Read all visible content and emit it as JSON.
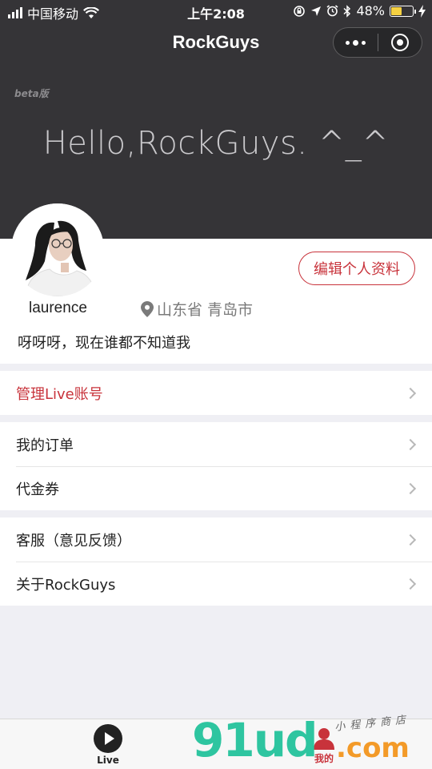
{
  "status_bar": {
    "carrier": "中国移动",
    "time": "上午2:08",
    "battery_text": "48%",
    "battery_level": 0.48
  },
  "nav": {
    "title": "RockGuys"
  },
  "hero": {
    "beta_label": "beta版",
    "greeting": "Hello,RockGuys. ^_^"
  },
  "profile": {
    "username": "laurence",
    "location": "山东省 青岛市",
    "bio": "呀呀呀，现在谁都不知道我",
    "edit_button": "编辑个人资料"
  },
  "menu": {
    "group1": [
      {
        "label": "管理Live账号",
        "accent": true
      }
    ],
    "group2": [
      {
        "label": "我的订单"
      },
      {
        "label": "代金券"
      }
    ],
    "group3": [
      {
        "label": "客服（意见反馈）"
      },
      {
        "label": "关于RockGuys"
      }
    ]
  },
  "tabs": {
    "live": "Live",
    "mine": "我的"
  },
  "watermark": {
    "main": "91ud",
    "domain": ".com",
    "tagline": "小程序商店"
  },
  "colors": {
    "header_bg": "#353437",
    "accent_red": "#c8333b",
    "watermark_green": "#2ec5a0",
    "watermark_orange": "#f39a28"
  }
}
